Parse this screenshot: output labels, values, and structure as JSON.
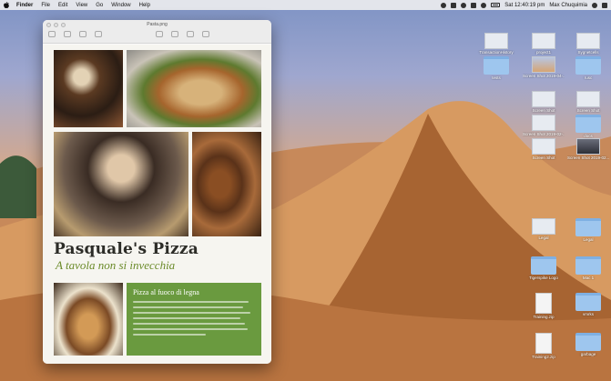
{
  "menubar": {
    "app": "Finder",
    "items": [
      "File",
      "Edit",
      "View",
      "Go",
      "Window",
      "Help"
    ],
    "clock": "Sat 12:40:19 pm",
    "user": "Max Chuquimia"
  },
  "preview": {
    "title": "Pasta.png"
  },
  "poster": {
    "headline": "Pasquale's Pizza",
    "tagline": "A tavola non si invecchia",
    "box_title": "Pizza al fuoco di legna"
  },
  "desktop": {
    "icons": [
      {
        "label": "TransactionHistory",
        "kind": "shot"
      },
      {
        "label": "project1",
        "kind": "shot"
      },
      {
        "label": "Sygnetcells",
        "kind": "shot"
      },
      {
        "label": "tests",
        "kind": "folder"
      },
      {
        "label": "Screen Shot 2019-04-...",
        "kind": "shot"
      },
      {
        "label": "rusc",
        "kind": "folder"
      },
      {
        "label": "Screen Shot",
        "kind": "shot"
      },
      {
        "label": "Screen Shot",
        "kind": "shot"
      },
      {
        "label": "Screen Shot 2019-02-...",
        "kind": "shot"
      },
      {
        "label": "docs",
        "kind": "folder"
      },
      {
        "label": "Screen Shot",
        "kind": "shot"
      },
      {
        "label": "Screen Shot 2019-02...",
        "kind": "shot"
      },
      {
        "label": "Legal",
        "kind": "folder"
      },
      {
        "label": "Tigerspike Logo",
        "kind": "folder"
      },
      {
        "label": "Mac 1",
        "kind": "folder"
      },
      {
        "label": "Training.zip",
        "kind": "zip"
      },
      {
        "label": "vmrks",
        "kind": "folder"
      },
      {
        "label": "Training2.zip",
        "kind": "zip"
      },
      {
        "label": "garbage",
        "kind": "folder"
      }
    ]
  }
}
